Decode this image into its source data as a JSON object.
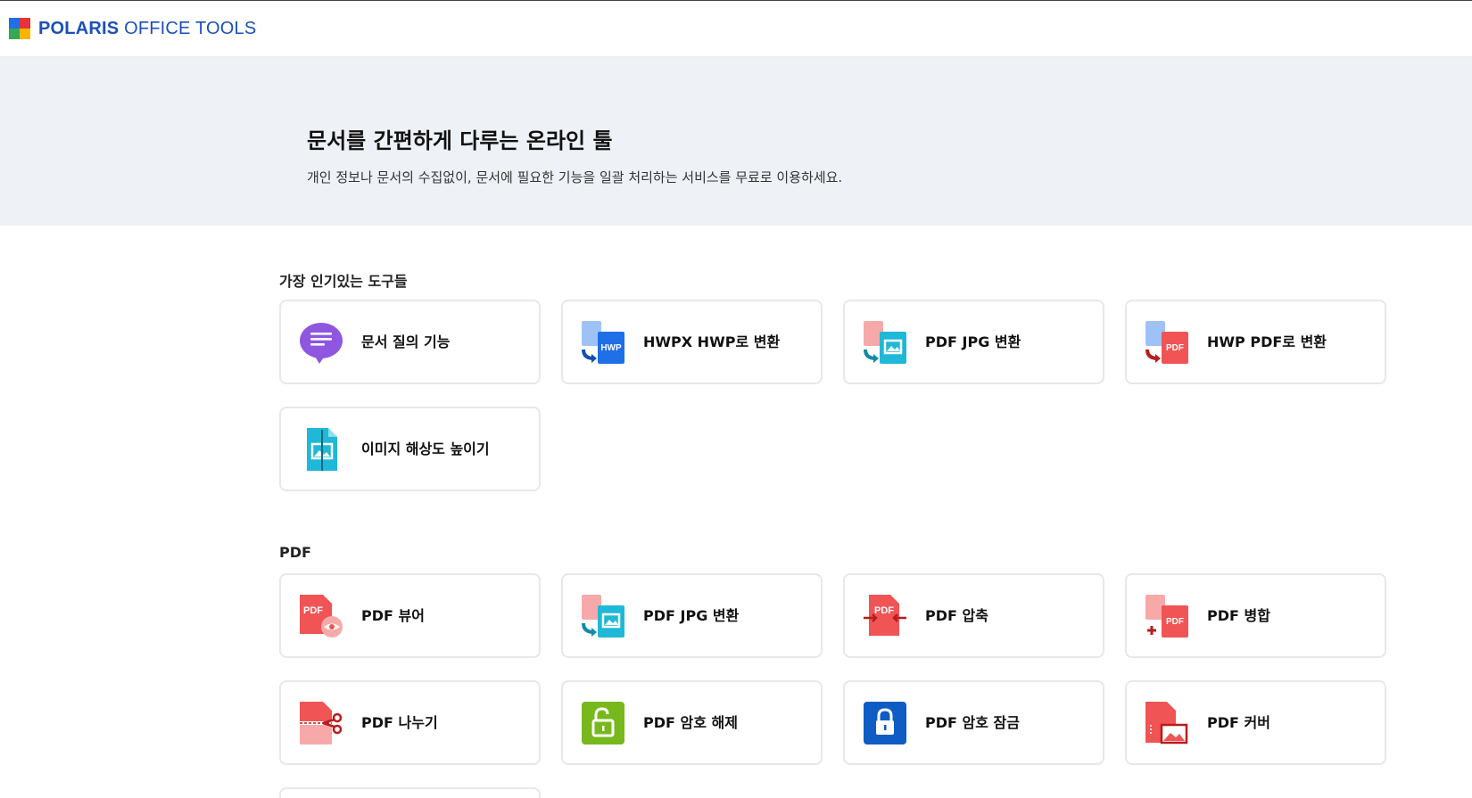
{
  "header": {
    "logo_primary": "POLARIS",
    "logo_secondary": "OFFICE TOOLS",
    "logo_colors": [
      "#1e6fe8",
      "#e8323a",
      "#f7b500",
      "#34a853"
    ]
  },
  "hero": {
    "title": "문서를 간편하게 다루는 온라인 툴",
    "subtitle": "개인 정보나 문서의 수집없이, 문서에 필요한 기능을 일괄 처리하는 서비스를 무료로 이용하세요."
  },
  "sections": {
    "popular": {
      "title": "가장 인기있는 도구들",
      "tools": [
        {
          "label": "문서 질의 기능",
          "icon": "chat-bubble-icon"
        },
        {
          "label": "HWPX HWP로 변환",
          "icon": "hwpx-to-hwp-icon"
        },
        {
          "label": "PDF JPG 변환",
          "icon": "pdf-to-jpg-icon"
        },
        {
          "label": "HWP PDF로 변환",
          "icon": "hwp-to-pdf-icon"
        },
        {
          "label": "이미지 해상도 높이기",
          "icon": "image-upscale-icon"
        }
      ]
    },
    "pdf": {
      "title": "PDF",
      "tools": [
        {
          "label": "PDF 뷰어",
          "icon": "pdf-viewer-icon"
        },
        {
          "label": "PDF JPG 변환",
          "icon": "pdf-to-jpg-icon"
        },
        {
          "label": "PDF 압축",
          "icon": "pdf-compress-icon"
        },
        {
          "label": "PDF 병합",
          "icon": "pdf-merge-icon"
        },
        {
          "label": "PDF 나누기",
          "icon": "pdf-split-icon"
        },
        {
          "label": "PDF 암호 해제",
          "icon": "unlock-icon"
        },
        {
          "label": "PDF 암호 잠금",
          "icon": "lock-icon"
        },
        {
          "label": "PDF 커버",
          "icon": "pdf-cover-icon"
        }
      ]
    }
  },
  "icon_text": {
    "hwp": "HWP",
    "pdf": "PDF"
  },
  "colors": {
    "hwp_blue": "#1e6fe8",
    "pdf_red": "#f05454",
    "jpg_teal": "#1fb8d8",
    "chat_purple": "#8f56e0",
    "unlock_green": "#77b81c",
    "lock_blue": "#0f5cc4"
  }
}
